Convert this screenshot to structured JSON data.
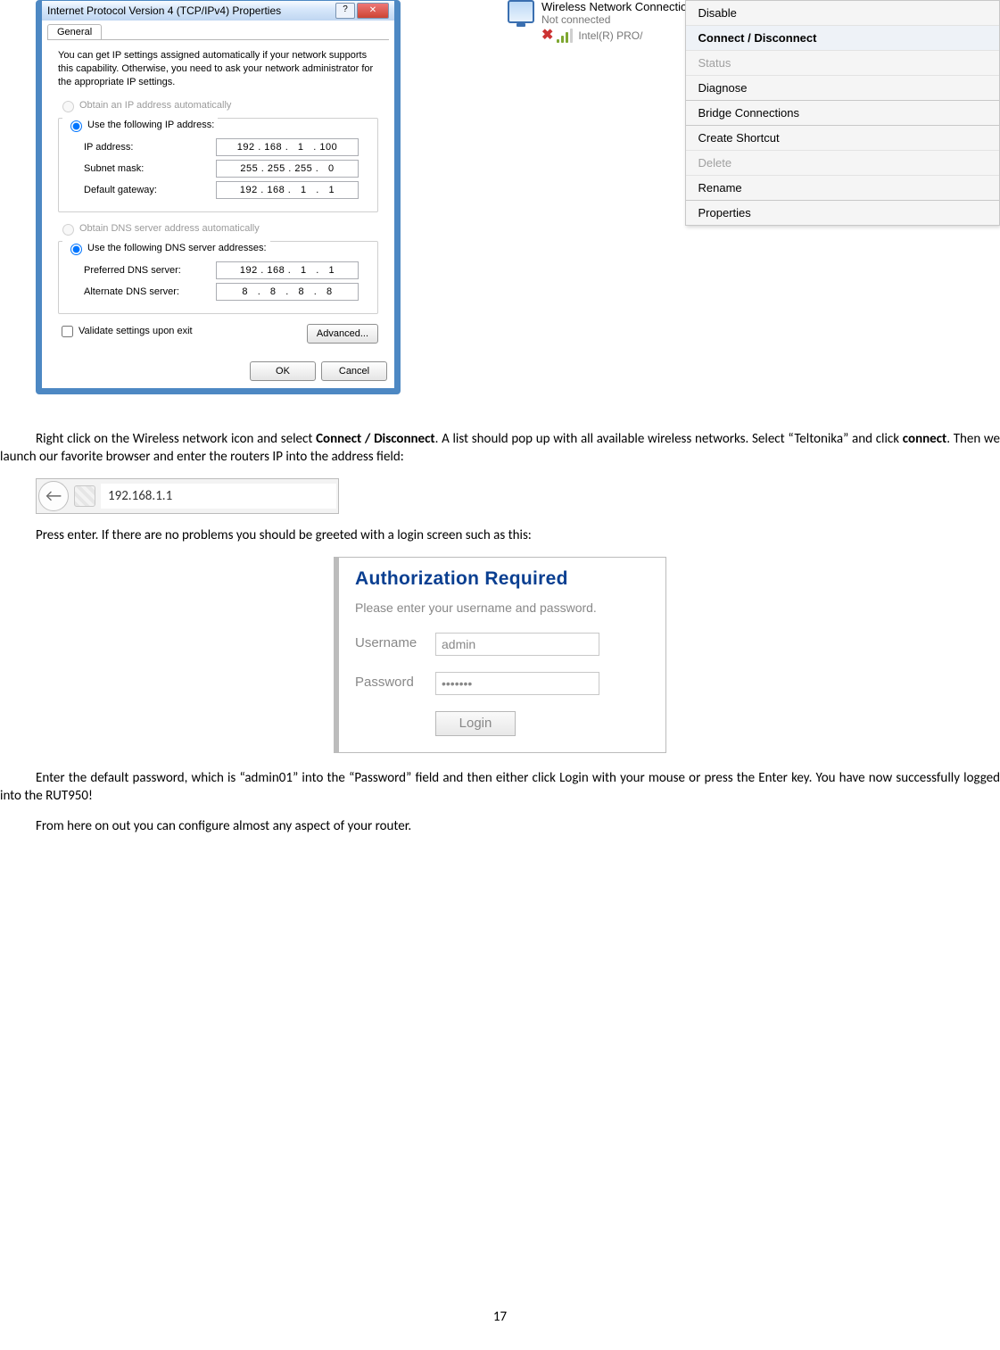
{
  "tcpip": {
    "title": "Internet Protocol Version 4 (TCP/IPv4) Properties",
    "tab": "General",
    "intro": "You can get IP settings assigned automatically if your network supports this capability. Otherwise, you need to ask your network administrator for the appropriate IP settings.",
    "radio_obtain_ip": "Obtain an IP address automatically",
    "radio_use_ip": "Use the following IP address:",
    "ip_label": "IP address:",
    "ip_value": "192 . 168 .   1   . 100",
    "subnet_label": "Subnet mask:",
    "subnet_value": "255 . 255 . 255 .   0",
    "gateway_label": "Default gateway:",
    "gateway_value": "192 . 168 .   1   .   1",
    "radio_obtain_dns": "Obtain DNS server address automatically",
    "radio_use_dns": "Use the following DNS server addresses:",
    "pref_dns_label": "Preferred DNS server:",
    "pref_dns_value": "192 . 168 .   1   .   1",
    "alt_dns_label": "Alternate DNS server:",
    "alt_dns_value": "8   .   8   .   8   .   8",
    "validate": "Validate settings upon exit",
    "advanced": "Advanced...",
    "ok": "OK",
    "cancel": "Cancel",
    "help_glyph": "?",
    "close_glyph": "✕"
  },
  "wireless": {
    "title": "Wireless Network Connection",
    "status": "Not connected",
    "adapter": "Intel(R) PRO/"
  },
  "menu": {
    "items": [
      {
        "label": "Disable",
        "state": "enabled"
      },
      {
        "label": "Connect / Disconnect",
        "state": "selected"
      },
      {
        "label": "Status",
        "state": "disabled"
      },
      {
        "label": "Diagnose",
        "state": "enabled"
      },
      {
        "label": "Bridge Connections",
        "state": "enabled"
      },
      {
        "label": "Create Shortcut",
        "state": "enabled"
      },
      {
        "label": "Delete",
        "state": "disabled"
      },
      {
        "label": "Rename",
        "state": "enabled"
      },
      {
        "label": "Properties",
        "state": "enabled"
      }
    ]
  },
  "addressbar": {
    "url": "192.168.1.1",
    "back_glyph": "←"
  },
  "text": {
    "p1_a": "Right click on the Wireless network icon and select ",
    "p1_b": "Connect / Disconnect",
    "p1_c": ". A list should pop up with all available wireless networks. Select “Teltonika” and click ",
    "p1_d": "connect",
    "p1_e": ". Then we launch our favorite browser and enter the routers IP into the address field:",
    "p2": "Press enter. If there are no problems you should be greeted with a login screen such as this:",
    "p3": "Enter the default password, which is “admin01” into the “Password” field and then either click Login with your mouse or press the Enter key. You have now successfully logged into the RUT950!",
    "p4": "From here on out you can configure almost any aspect of your router."
  },
  "login": {
    "title": "Authorization Required",
    "subtitle": "Please enter your username and password.",
    "user_label": "Username",
    "user_value": "admin",
    "pass_label": "Password",
    "pass_value": "•••••••",
    "button": "Login"
  },
  "page_number": "17"
}
